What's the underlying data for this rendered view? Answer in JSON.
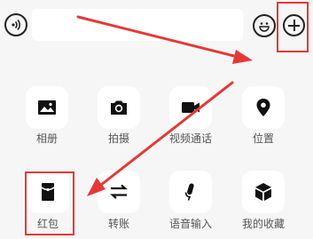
{
  "input_bar": {
    "voice_icon": "voice-wave-icon",
    "emoji_icon": "smiley-icon",
    "plus_icon": "plus-circle-icon",
    "text_value": ""
  },
  "panel": {
    "items": [
      {
        "label": "相册",
        "icon": "image-icon"
      },
      {
        "label": "拍摄",
        "icon": "camera-icon"
      },
      {
        "label": "视频通话",
        "icon": "video-camera-icon"
      },
      {
        "label": "位置",
        "icon": "location-pin-icon"
      },
      {
        "label": "红包",
        "icon": "red-envelope-icon"
      },
      {
        "label": "转账",
        "icon": "transfer-arrows-icon"
      },
      {
        "label": "语音输入",
        "icon": "microphone-icon"
      },
      {
        "label": "我的收藏",
        "icon": "cube-icon"
      }
    ]
  },
  "annotations": {
    "arrow_color": "#e53935",
    "highlight_color": "#e53935"
  }
}
